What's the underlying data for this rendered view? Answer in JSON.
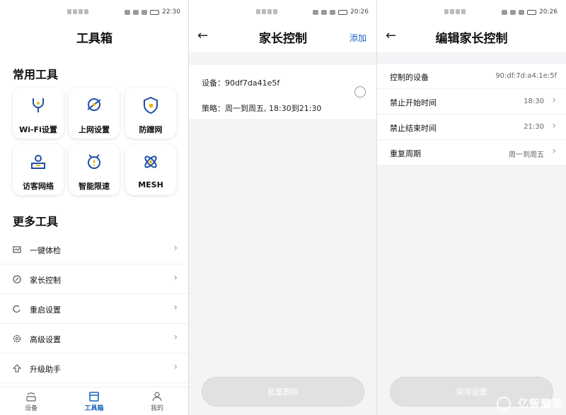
{
  "panels": {
    "toolbox": {
      "status_time": "22:30",
      "title": "工具箱",
      "common_title": "常用工具",
      "common_tools": [
        {
          "label": "Wi-Fi设置",
          "icon": "wifi-settings-icon"
        },
        {
          "label": "上网设置",
          "icon": "internet-settings-icon"
        },
        {
          "label": "防蹭网",
          "icon": "shield-icon"
        },
        {
          "label": "访客网络",
          "icon": "guest-network-icon"
        },
        {
          "label": "智能限速",
          "icon": "speed-limit-icon"
        },
        {
          "label": "MESH",
          "icon": "mesh-icon"
        }
      ],
      "more_title": "更多工具",
      "more_tools": [
        {
          "label": "一键体检",
          "icon": "checkup-icon"
        },
        {
          "label": "家长控制",
          "icon": "parental-control-icon"
        },
        {
          "label": "重启设置",
          "icon": "restart-icon"
        },
        {
          "label": "高级设置",
          "icon": "gear-icon"
        },
        {
          "label": "升级助手",
          "icon": "upgrade-icon"
        }
      ],
      "nav": [
        {
          "label": "设备",
          "icon": "router-icon"
        },
        {
          "label": "工具箱",
          "icon": "toolbox-icon"
        },
        {
          "label": "我的",
          "icon": "user-icon"
        }
      ]
    },
    "parental": {
      "status_time": "20:26",
      "title": "家长控制",
      "add_label": "添加",
      "device_line": "设备：90df7da41e5f",
      "policy_line": "策略：周一到周五, 18:30到21:30",
      "delete_label": "批量删除"
    },
    "edit": {
      "status_time": "20:26",
      "title": "编辑家长控制",
      "rows": [
        {
          "key": "控制的设备",
          "value": "90:df:7d:a4:1e:5f"
        },
        {
          "key": "禁止开始时间",
          "value": "18:30"
        },
        {
          "key": "禁止结束时间",
          "value": "21:30"
        },
        {
          "key": "重复周期",
          "value": "周一到周五"
        }
      ],
      "save_label": "保存设置",
      "watermark": "亿智蘭苑"
    }
  },
  "colors": {
    "accent": "#1565c0",
    "icon": "#1e4fa8",
    "disabled_button": "#e1e1e1"
  }
}
